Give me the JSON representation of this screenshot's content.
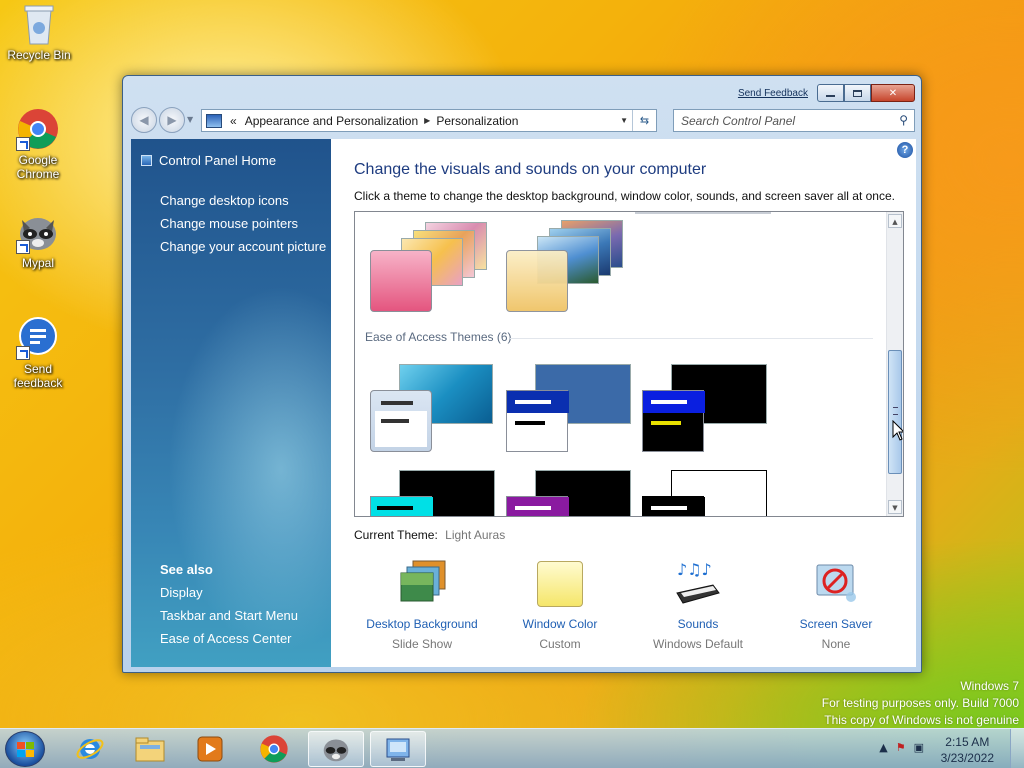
{
  "desktop": {
    "icons": [
      {
        "label": "Recycle Bin"
      },
      {
        "label": "Google Chrome"
      },
      {
        "label": "Mypal"
      },
      {
        "label": "Send feedback"
      }
    ]
  },
  "window": {
    "send_feedback": "Send Feedback",
    "address": {
      "back_chevrons": "«",
      "crumb1": "Appearance and Personalization",
      "sep": "▶",
      "crumb2": "Personalization"
    },
    "search_placeholder": "Search Control Panel",
    "help": "?"
  },
  "sidebar": {
    "home": "Control Panel Home",
    "links": [
      "Change desktop icons",
      "Change mouse pointers",
      "Change your account picture"
    ],
    "see_also_header": "See also",
    "see_also": [
      "Display",
      "Taskbar and Start Menu",
      "Ease of Access Center"
    ]
  },
  "content": {
    "title": "Change the visuals and sounds on your computer",
    "subtitle": "Click a theme to change the desktop background, window color, sounds, and screen saver all at once.",
    "group_header": "Ease of Access Themes (6)",
    "current_theme_label": "Current Theme:",
    "current_theme_value": "Light Auras",
    "settings": [
      {
        "label": "Desktop Background",
        "value": "Slide Show"
      },
      {
        "label": "Window Color",
        "value": "Custom"
      },
      {
        "label": "Sounds",
        "value": "Windows Default"
      },
      {
        "label": "Screen Saver",
        "value": "None"
      }
    ]
  },
  "watermark": {
    "line1": "Windows 7",
    "line2": "For testing purposes only. Build 7000",
    "line3": "This copy of Windows is not genuine"
  },
  "taskbar": {
    "time": "2:15 AM",
    "date": "3/23/2022"
  },
  "colors": {
    "sidebar_top": "#20538c",
    "sidebar_bottom": "#41a0c2",
    "link_blue": "#1f5fb3",
    "title_blue": "#1e3c80"
  }
}
